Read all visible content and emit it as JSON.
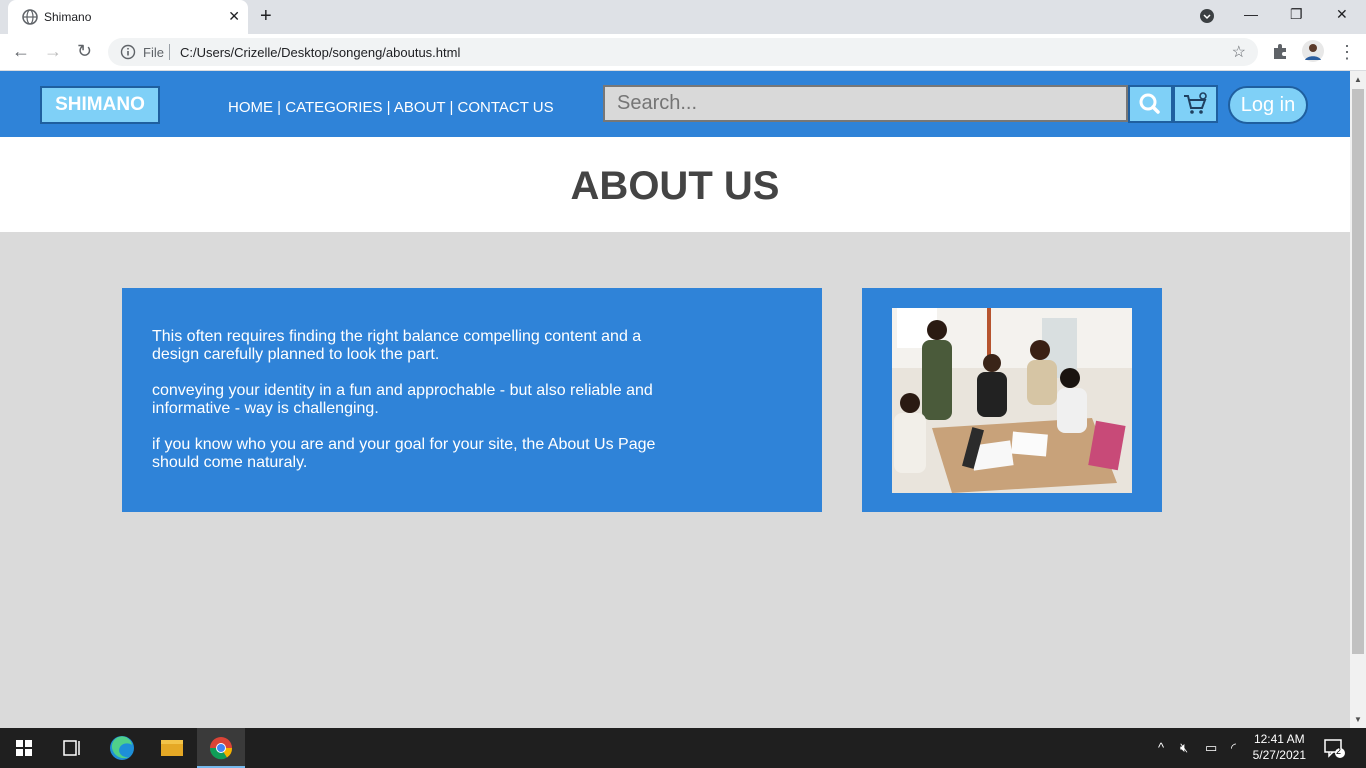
{
  "browser": {
    "tab_title": "Shimano",
    "address_scheme": "File",
    "url": "C:/Users/Crizelle/Desktop/songeng/aboutus.html"
  },
  "header": {
    "logo": "SHIMANO",
    "nav": {
      "home": "HOME",
      "categories": "CATEGORIES",
      "about": "ABOUT",
      "contact": "CONTACT US",
      "separator": " | "
    },
    "search_placeholder": "Search...",
    "login_label": "Log in"
  },
  "hero": {
    "title": "ABOUT US"
  },
  "content": {
    "paragraphs": [
      "This often requires finding the right balance compelling content and a design carefully planned to look the part.",
      "conveying your identity in a fun and approchable - but also reliable and informative - way is challenging.",
      "if you know who you are and your goal for your site, the About Us Page should come naturaly."
    ]
  },
  "taskbar": {
    "time": "12:41 AM",
    "date": "5/27/2021",
    "notifications": "2"
  },
  "colors": {
    "primary_blue": "#2f83d8",
    "accent_light_blue": "#7fd0f7",
    "page_bg": "#dadada"
  }
}
